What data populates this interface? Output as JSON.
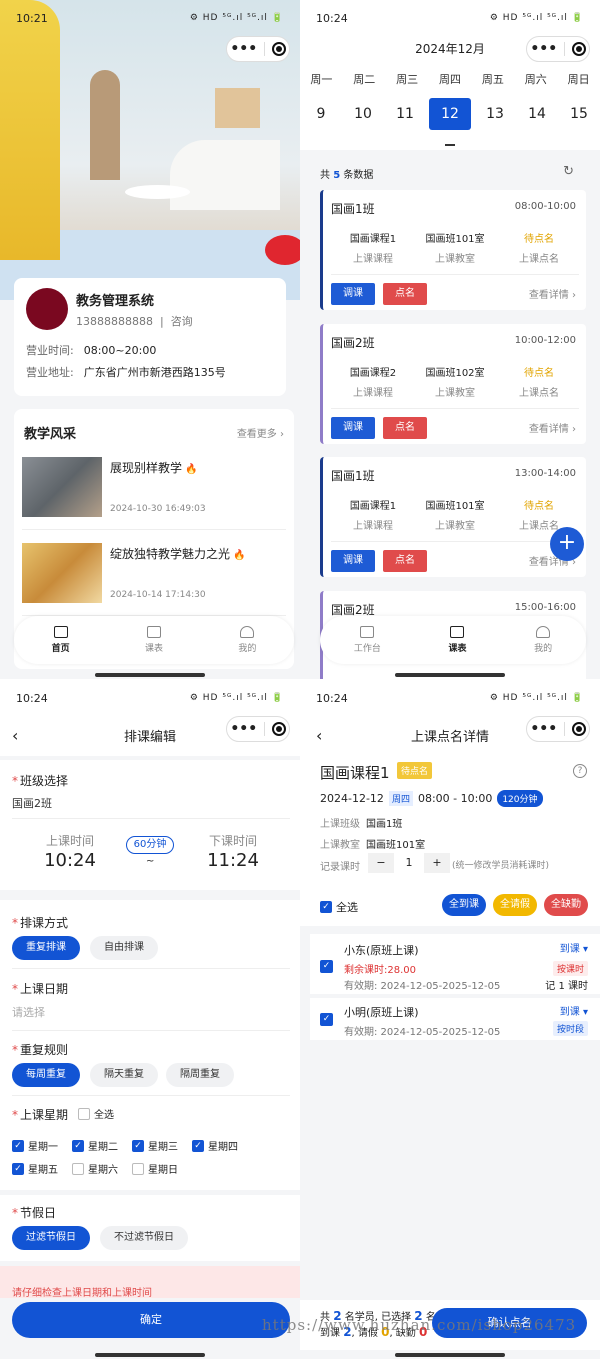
{
  "status": {
    "t1": "10:21",
    "t2": "10:24",
    "t3": "10:24",
    "t4": "10:24",
    "icons": "⚙ HD ⁵ᴳ.ıl ⁵ᴳ.ıl 🔋"
  },
  "home": {
    "name": "教务管理系统",
    "phone": "13888888888",
    "consult": "咨询",
    "hours_label": "营业时间:",
    "hours": "08:00~20:00",
    "addr_label": "营业地址:",
    "addr": "广东省广州市新港西路135号",
    "section": "教学风采",
    "more": "查看更多 ›",
    "articles": [
      {
        "title": "展现别样教学",
        "time": "2024-10-30 16:49:03"
      },
      {
        "title": "绽放独特教学魅力之光",
        "time": "2024-10-14 17:14:30"
      }
    ],
    "tabs": [
      "首页",
      "课表",
      "我的"
    ]
  },
  "schedule": {
    "month": "2024年12月",
    "weekdays": [
      "周一",
      "周二",
      "周三",
      "周四",
      "周五",
      "周六",
      "周日"
    ],
    "dates": [
      "9",
      "10",
      "11",
      "12",
      "13",
      "14",
      "15"
    ],
    "count_pre": "共",
    "count": "5",
    "count_post": "条数据",
    "classes": [
      {
        "name": "国画1班",
        "time": "08:00-10:00",
        "course": "国画课程1",
        "room": "国画班101室",
        "status": "待点名"
      },
      {
        "name": "国画2班",
        "time": "10:00-12:00",
        "course": "国画课程2",
        "room": "国画班102室",
        "status": "待点名"
      },
      {
        "name": "国画1班",
        "time": "13:00-14:00",
        "course": "国画课程1",
        "room": "国画班101室",
        "status": "待点名"
      },
      {
        "name": "国画2班",
        "time": "15:00-16:00"
      }
    ],
    "sub_course": "上课课程",
    "sub_room": "上课教室",
    "sub_status": "上课点名",
    "btn_adjust": "调课",
    "btn_roll": "点名",
    "detail": "查看详情 ›",
    "tabs": [
      "工作台",
      "课表",
      "我的"
    ]
  },
  "edit": {
    "title": "排课编辑",
    "class_label": "班级选择",
    "class_val": "国画2班",
    "start_label": "上课时间",
    "start": "10:24",
    "duration": "60分钟",
    "tilde": "~",
    "end_label": "下课时间",
    "end": "11:24",
    "mode_label": "排课方式",
    "mode_opts": [
      "重复排课",
      "自由排课"
    ],
    "date_label": "上课日期",
    "date_ph": "请选择",
    "rule_label": "重复规则",
    "rule_opts": [
      "每周重复",
      "隔天重复",
      "隔周重复"
    ],
    "week_label": "上课星期",
    "select_all": "全选",
    "week_days": [
      "星期一",
      "星期二",
      "星期三",
      "星期四",
      "星期五",
      "星期六",
      "星期日"
    ],
    "holiday_label": "节假日",
    "holiday_opts": [
      "过滤节假日",
      "不过滤节假日"
    ],
    "warn": "请仔细检查上课日期和上课时间",
    "confirm": "确定"
  },
  "roll": {
    "title": "上课点名详情",
    "course": "国画课程1",
    "tag": "待点名",
    "date": "2024-12-12",
    "week": "周四",
    "time": "08:00 - 10:00",
    "minutes": "120分钟",
    "class_k": "上课班级",
    "class_v": "国画1班",
    "room_k": "上课教室",
    "room_v": "国画班101室",
    "hours_k": "记录课时",
    "hours_v": "1",
    "minus": "−",
    "plus": "+",
    "hours_note": "(统一修改学员消耗课时)",
    "select_all": "全选",
    "all_present": "全到课",
    "all_leave": "全请假",
    "all_absent": "全缺勤",
    "students": [
      {
        "name": "小东(原班上课)",
        "remain": "剩余课时:28.00",
        "valid": "有效期: 2024-12-05-2025-12-05",
        "status": "到课 ▾",
        "tag": "按课时",
        "cost": "记 1 课时"
      },
      {
        "name": "小明(原班上课)",
        "valid": "有效期: 2024-12-05-2025-12-05",
        "status": "到课 ▾",
        "tag": "按时段"
      }
    ],
    "foot1_a": "共",
    "foot1_b": "2",
    "foot1_c": "名学员, 已选择",
    "foot1_d": "2",
    "foot1_e": "名",
    "foot2_a": "到课",
    "foot2_b": "2",
    "foot2_c": ", 请假",
    "foot2_d": "0",
    "foot2_e": ", 缺勤",
    "foot2_f": "0",
    "confirm": "确认点名"
  },
  "watermark": "https://www.huzhan.com/ishop26473",
  "colors": {
    "primary": "#1254d4",
    "danger": "#e04b4b",
    "warning": "#e2a400"
  }
}
